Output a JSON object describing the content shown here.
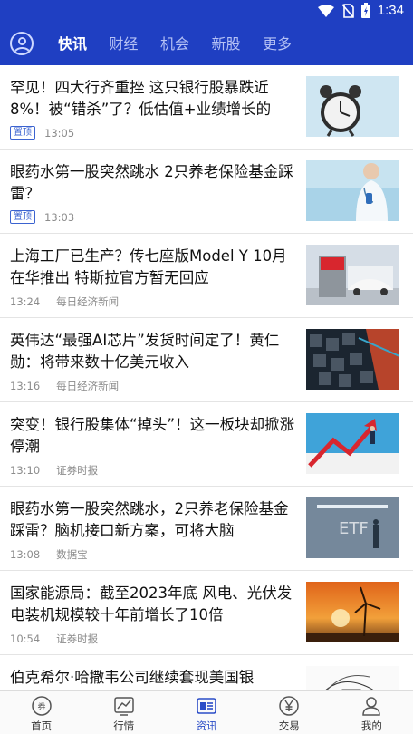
{
  "status_bar": {
    "time": "1:34",
    "icons": [
      "wifi-icon",
      "no-sim-icon",
      "battery-icon"
    ]
  },
  "header": {
    "avatar_icon": "user-circle-icon",
    "tabs": [
      {
        "label": "快讯",
        "active": true
      },
      {
        "label": "财经",
        "active": false
      },
      {
        "label": "机会",
        "active": false
      },
      {
        "label": "新股",
        "active": false
      },
      {
        "label": "更多",
        "active": false
      }
    ],
    "bg_color": "#1f3fc2"
  },
  "news": [
    {
      "title": "罕见！四大行齐重挫 这只银行股暴跌近8%！被“错杀”了？低估值+业绩增长的",
      "badge": "置顶",
      "time": "13:05",
      "source": "",
      "thumb": "alarm-clock-image"
    },
    {
      "title": "眼药水第一股突然跳水 2只养老保险基金踩雷？",
      "badge": "置顶",
      "time": "13:03",
      "source": "",
      "thumb": "doctor-image"
    },
    {
      "title": "上海工厂已生产？传七座版Model Y 10月在华推出 特斯拉官方暂无回应",
      "badge": "",
      "time": "13:24",
      "source": "每日经济新闻",
      "thumb": "tesla-station-image"
    },
    {
      "title": "英伟达“最强AI芯片”发货时间定了！黄仁勋：将带来数十亿美元收入",
      "badge": "",
      "time": "13:16",
      "source": "每日经济新闻",
      "thumb": "chip-image"
    },
    {
      "title": "突变！银行股集体“掉头”！这一板块却掀涨停潮",
      "badge": "",
      "time": "13:10",
      "source": "证券时报",
      "thumb": "arrow-chart-image"
    },
    {
      "title": "眼药水第一股突然跳水，2只养老保险基金踩雷？脑机接口新方案，可将大脑",
      "badge": "",
      "time": "13:08",
      "source": "数据宝",
      "thumb": "etf-image"
    },
    {
      "title": "国家能源局：截至2023年底 风电、光伏发电装机规模较十年前增长了10倍",
      "badge": "",
      "time": "10:54",
      "source": "证券时报",
      "thumb": "wind-turbine-image"
    },
    {
      "title": "伯克希尔·哈撒韦公司继续套现美国银",
      "badge": "",
      "time": "",
      "source": "",
      "thumb": "sketch-image"
    }
  ],
  "bottom_nav": [
    {
      "label": "首页",
      "icon": "coupon-icon",
      "active": false
    },
    {
      "label": "行情",
      "icon": "chart-icon",
      "active": false
    },
    {
      "label": "资讯",
      "icon": "news-icon",
      "active": true
    },
    {
      "label": "交易",
      "icon": "yen-coin-icon",
      "active": false
    },
    {
      "label": "我的",
      "icon": "person-icon",
      "active": false
    }
  ]
}
